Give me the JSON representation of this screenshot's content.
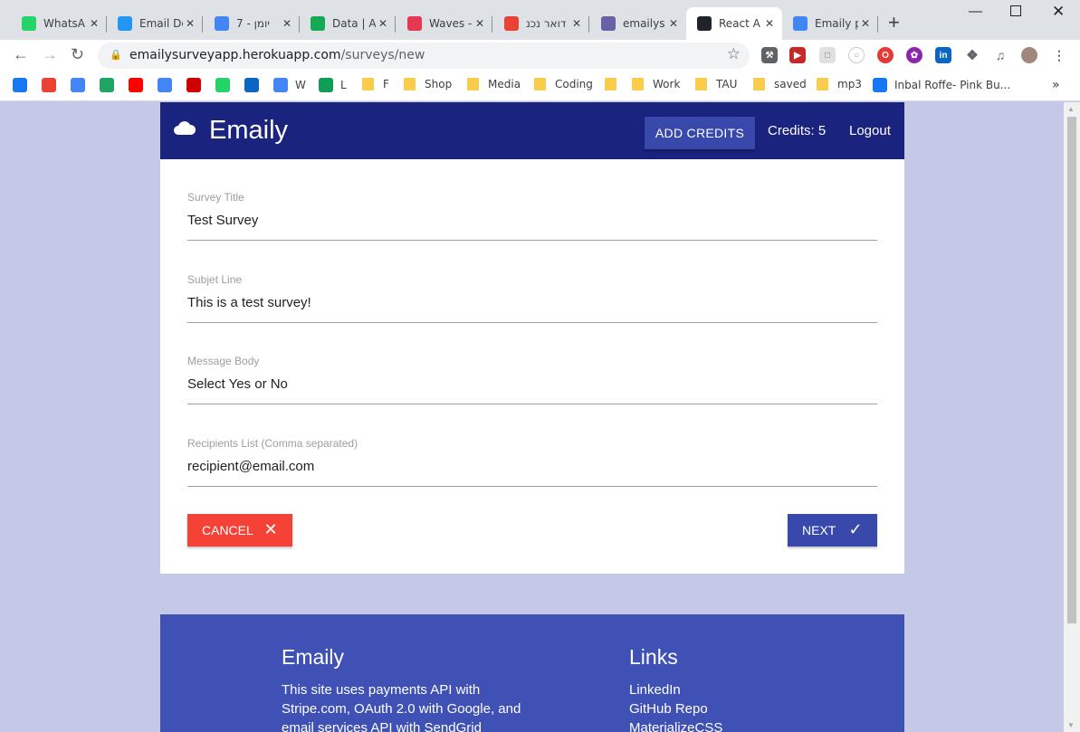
{
  "browser": {
    "tabs": [
      {
        "title": "WhatsA",
        "icon": "whatsapp-icon",
        "color": "#25d366"
      },
      {
        "title": "Email De",
        "icon": "email-icon",
        "color": "#2196f3"
      },
      {
        "title": "יומן - 7",
        "icon": "calendar-icon",
        "color": "#4285f4"
      },
      {
        "title": "Data | A",
        "icon": "mongodb-leaf-icon",
        "color": "#13aa52"
      },
      {
        "title": "Waves -",
        "icon": "waves-icon",
        "color": "#e53950"
      },
      {
        "title": "דואר נכנ",
        "icon": "gmail-icon",
        "color": "#ea4335"
      },
      {
        "title": "emailys",
        "icon": "heroku-icon",
        "color": "#6762a6"
      },
      {
        "title": "React A",
        "icon": "react-icon",
        "color": "#20232a"
      },
      {
        "title": "Emaily p",
        "icon": "google-icon",
        "color": "#4285f4"
      }
    ],
    "url_host": "emailysurveyapp.herokuapp.com",
    "url_path": "/surveys/new",
    "bookmarks": [
      {
        "label": "",
        "icon": "facebook-icon",
        "color": "#1877f2"
      },
      {
        "label": "",
        "icon": "gmail-icon",
        "color": "#ea4335"
      },
      {
        "label": "",
        "icon": "calendar-icon",
        "color": "#4285f4"
      },
      {
        "label": "",
        "icon": "drive-icon",
        "color": "#1fa463"
      },
      {
        "label": "",
        "icon": "youtube-icon",
        "color": "#ff0000"
      },
      {
        "label": "",
        "icon": "translate-icon",
        "color": "#4285f4"
      },
      {
        "label": "",
        "icon": "yahoo-icon",
        "color": "#cc0000"
      },
      {
        "label": "",
        "icon": "whatsapp-icon",
        "color": "#25d366"
      },
      {
        "label": "",
        "icon": "linkedin-icon",
        "color": "#0a66c2"
      },
      {
        "label": "W",
        "icon": "google-icon",
        "color": "#4285f4"
      },
      {
        "label": "L",
        "icon": "sheets-icon",
        "color": "#0f9d58"
      },
      {
        "label": "F",
        "icon": "folder-icon",
        "color": "#f9cd4b"
      },
      {
        "label": "Shop",
        "icon": "folder-icon",
        "color": "#f9cd4b"
      },
      {
        "label": "Media",
        "icon": "folder-icon",
        "color": "#f9cd4b"
      },
      {
        "label": "Coding",
        "icon": "folder-icon",
        "color": "#f9cd4b"
      },
      {
        "label": "",
        "icon": "folder-icon",
        "color": "#f9cd4b"
      },
      {
        "label": "Work",
        "icon": "folder-icon",
        "color": "#f9cd4b"
      },
      {
        "label": "TAU",
        "icon": "folder-icon",
        "color": "#f9cd4b"
      },
      {
        "label": "saved",
        "icon": "folder-icon",
        "color": "#f9cd4b"
      },
      {
        "label": "mp3",
        "icon": "folder-icon",
        "color": "#f9cd4b"
      },
      {
        "label": "Inbal Roffe- Pink Bu...",
        "icon": "facebook-icon",
        "color": "#1877f2"
      }
    ]
  },
  "app": {
    "brand": "Emaily",
    "add_credits": "ADD CREDITS",
    "credits": "Credits: 5",
    "logout": "Logout",
    "nav_color": "#1a237e",
    "accent": "#3949ab"
  },
  "form": {
    "fields": [
      {
        "label": "Survey Title",
        "value": "Test Survey"
      },
      {
        "label": "Subjet Line",
        "value": "This is a test survey!"
      },
      {
        "label": "Message Body",
        "value": "Select Yes or No"
      },
      {
        "label": "Recipients List (Comma separated)",
        "value": "recipient@email.com"
      }
    ],
    "cancel_label": "CANCEL",
    "next_label": "NEXT",
    "cancel_color": "#f44336"
  },
  "footer": {
    "title": "Emaily",
    "text": "This site uses payments API with Stripe.com, OAuth 2.0 with Google, and email services API with SendGrid",
    "links_title": "Links",
    "links": [
      "LinkedIn",
      "GitHub Repo",
      "MaterializeCSS"
    ]
  }
}
